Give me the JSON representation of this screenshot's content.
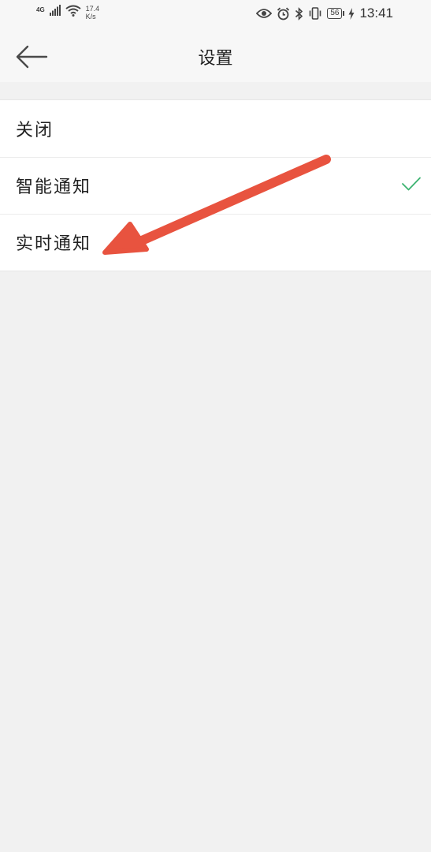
{
  "status_bar": {
    "network_type": "4G",
    "speed_value": "17.4",
    "speed_unit": "K/s",
    "battery_level": "56",
    "time": "13:41"
  },
  "header": {
    "title": "设置"
  },
  "options": [
    {
      "label": "关闭",
      "selected": false
    },
    {
      "label": "智能通知",
      "selected": true
    },
    {
      "label": "实时通知",
      "selected": false
    }
  ],
  "colors": {
    "check": "#3cb371",
    "annotation_arrow": "#e8533f",
    "background": "#f1f1f1"
  },
  "icons": {
    "back": "arrow-left-icon",
    "check": "check-icon",
    "annotation": "red-arrow-annotation"
  }
}
